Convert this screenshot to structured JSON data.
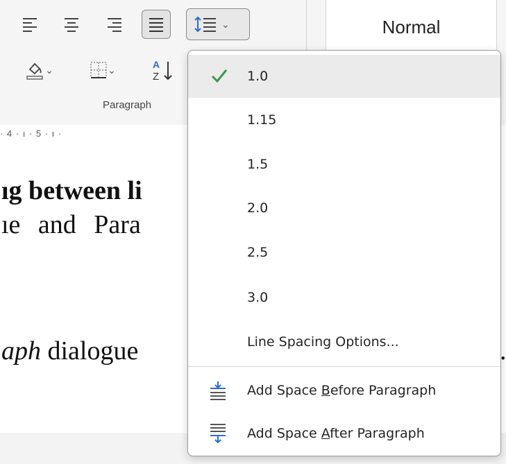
{
  "ribbon": {
    "align_left_icon": "align-left-icon",
    "align_center_icon": "align-center-icon",
    "align_right_icon": "align-right-icon",
    "justify_icon": "justify-icon",
    "line_spacing_icon": "line-paragraph-spacing-icon",
    "shading_icon": "shading-icon",
    "borders_icon": "borders-icon",
    "sort_icon": "sort-icon",
    "group_label": "Paragraph",
    "style_normal": "Normal",
    "accent_blue": "#2b6cd4"
  },
  "ruler": {
    "text": "· 4 · ı · 5 · ı ·"
  },
  "document": {
    "line1": "ıg between li",
    "line2": "ıe and Para",
    "line3_italic": "aph",
    "line3_rest": " dialogue",
    "trailing_period": "."
  },
  "line_spacing_menu": {
    "selected": "1.0",
    "check_color": "#3a9a48",
    "options": [
      "1.0",
      "1.15",
      "1.5",
      "2.0",
      "2.5",
      "3.0"
    ],
    "options_link": "Line Spacing Options...",
    "add_before": {
      "pre": "Add Space ",
      "key": "B",
      "post": "efore Paragraph",
      "icon": "add-space-before-icon"
    },
    "add_after": {
      "pre": "Add Space ",
      "key": "A",
      "post": "fter Paragraph",
      "icon": "add-space-after-icon"
    }
  }
}
